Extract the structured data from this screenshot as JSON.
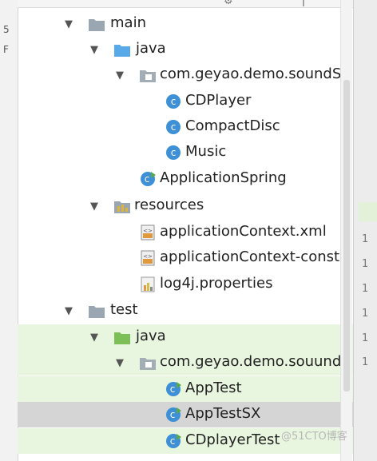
{
  "tree": {
    "rows": [
      {
        "label": "main",
        "icon": "folder-icon",
        "arrow": "expanded"
      },
      {
        "label": "java",
        "icon": "source-folder-icon",
        "arrow": "expanded"
      },
      {
        "label": "com.geyao.demo.soundSy",
        "icon": "package-icon",
        "arrow": "expanded"
      },
      {
        "label": "CDPlayer",
        "icon": "class-icon"
      },
      {
        "label": "CompactDisc",
        "icon": "class-icon"
      },
      {
        "label": "Music",
        "icon": "class-icon"
      },
      {
        "label": "ApplicationSpring",
        "icon": "runnable-class-icon"
      },
      {
        "label": "resources",
        "icon": "resources-folder-icon",
        "arrow": "expanded"
      },
      {
        "label": "applicationContext.xml",
        "icon": "xml-file-icon"
      },
      {
        "label": "applicationContext-const.x",
        "icon": "xml-file-icon"
      },
      {
        "label": "log4j.properties",
        "icon": "properties-file-icon"
      },
      {
        "label": "test",
        "icon": "folder-icon",
        "arrow": "expanded"
      },
      {
        "label": "java",
        "icon": "test-folder-icon",
        "arrow": "expanded"
      },
      {
        "label": "com.geyao.demo.souundS",
        "icon": "package-icon",
        "arrow": "expanded"
      },
      {
        "label": "AppTest",
        "icon": "test-class-icon"
      },
      {
        "label": "AppTestSX",
        "icon": "test-class-icon",
        "selected": true
      },
      {
        "label": "CDplayerTest",
        "icon": "test-class-icon"
      }
    ]
  },
  "right_gutter": {
    "marks": [
      "1",
      "1",
      "1",
      "1",
      "1",
      "1"
    ]
  },
  "watermark": "@51CTO博客",
  "colors": {
    "test_row_bg": "#e9f6df",
    "selected_row_bg": "#d5d5d5",
    "class_icon": "#3d8fd6",
    "folder": "#9aa7b3",
    "source_folder": "#57a9e8",
    "test_folder": "#7cbf57"
  }
}
